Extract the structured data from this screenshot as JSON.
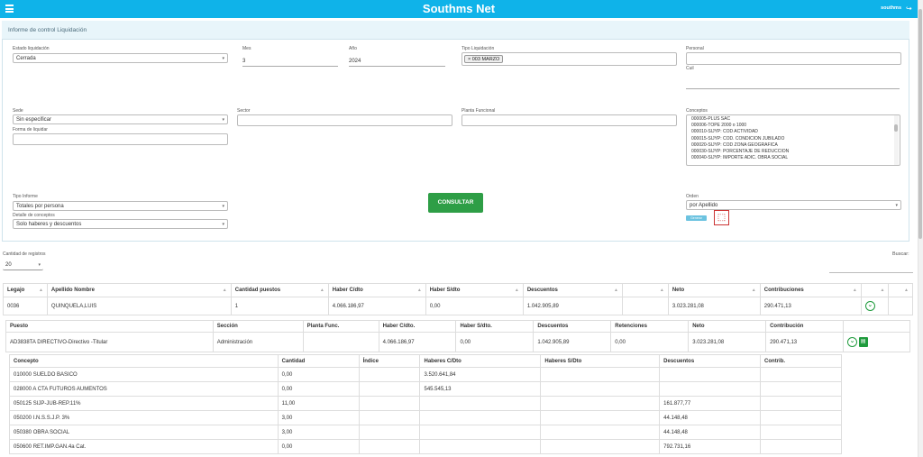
{
  "header": {
    "app_title": "Southms Net",
    "user": "southms"
  },
  "panel": {
    "title": "Informe de control Liquidación"
  },
  "filters": {
    "estado_label": "Estado liquidación",
    "estado_value": "Cerrada",
    "mes_label": "Mes",
    "mes_value": "3",
    "anio_label": "Año",
    "anio_value": "2024",
    "tipo_liq_label": "Tipo Liquidación",
    "tipo_liq_tag": "003 MARZO",
    "personal_label": "Personal",
    "cuil_label": "Cuil",
    "sede_label": "Sede",
    "sede_value": "Sin especificar",
    "sector_label": "Sector",
    "planta_label": "Planta Funcional",
    "forma_label": "Forma de liquidar",
    "conceptos_label": "Conceptos",
    "conceptos": [
      "000005-PLUS SAC",
      "000006-TOPE 2000 o 1000",
      "000010-SIJYP: COD ACTIVIDAD",
      "000015-SIJYP: COD. CONDICION JUBILADO",
      "000020-SIJYP: COD ZONA GEOGRAFICA",
      "000030-SIJYP: PORCENTAJE DE REDUCCION",
      "000040-SIJYP: IMPORTE ADIC. OBRA SOCIAL"
    ],
    "tipo_inf_label": "Tipo Informe",
    "tipo_inf_value": "Totales por persona",
    "detalle_label": "Detalle de conceptos",
    "detalle_value": "Solo haberes y descuentos",
    "orden_label": "Orden",
    "orden_value": "por Apellido",
    "consultar_label": "CONSULTAR",
    "small_btn_label": "Generar"
  },
  "results": {
    "count_label": "Cantidad de registros",
    "count_value": "20",
    "search_label": "Buscar:",
    "main_headers": [
      "Legajo",
      "Apellido Nombre",
      "Cantidad puestos",
      "Haber C/dto",
      "Haber S/dto",
      "Descuentos",
      "",
      "Neto",
      "Contribuciones",
      "",
      ""
    ],
    "main_row": [
      "0036",
      "QUINQUELA,LUIS",
      "1",
      "4.066.186,97",
      "0,00",
      "1.042.905,89",
      "",
      "3.023.281,08",
      "290.471,13"
    ],
    "puesto_headers": [
      "Puesto",
      "Sección",
      "Planta Func.",
      "Haber C/dto.",
      "Haber S/dto.",
      "Descuentos",
      "Retenciones",
      "Neto",
      "Contribución"
    ],
    "puesto_row": [
      "AD3838TA DIRECTIVO-Directivo -Titular",
      "Administración",
      "",
      "4.066.186,97",
      "0,00",
      "1.042.905,89",
      "0,00",
      "3.023.281,08",
      "290.471,13"
    ],
    "concept_headers": [
      "Concepto",
      "Cantidad",
      "Índice",
      "Haberes C/Dto",
      "Haberes S/Dto",
      "Descuentos",
      "Contrib."
    ],
    "concept_rows": [
      [
        "010000 SUELDO BASICO",
        "0,00",
        "",
        "3.520.641,84",
        "",
        "",
        ""
      ],
      [
        "028000 A CTA FUTUROS AUMENTOS",
        "0,00",
        "",
        "545.545,13",
        "",
        "",
        ""
      ],
      [
        "050125 SIJP-JUB-REP.11%",
        "11,00",
        "",
        "",
        "",
        "161.877,77",
        ""
      ],
      [
        "050200 I.N.S.S.J.P. 3%",
        "3,00",
        "",
        "",
        "",
        "44.148,48",
        ""
      ],
      [
        "050380 OBRA SOCIAL",
        "3,00",
        "",
        "",
        "",
        "44.148,48",
        ""
      ],
      [
        "050600 RET.IMP.GAN.4a Cat.",
        "0,00",
        "",
        "",
        "",
        "792.731,16",
        ""
      ]
    ]
  }
}
